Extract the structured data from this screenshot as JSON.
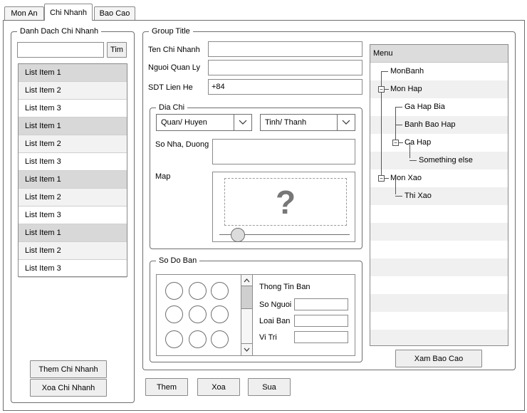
{
  "tabs": [
    {
      "label": "Mon An"
    },
    {
      "label": "Chi Nhanh"
    },
    {
      "label": "Bao Cao"
    }
  ],
  "branch_list": {
    "title": "Danh Dach Chi Nhanh",
    "search_value": "",
    "search_button": "Tim",
    "items": [
      {
        "label": "List Item 1"
      },
      {
        "label": "List Item 2"
      },
      {
        "label": "List Item 3"
      },
      {
        "label": "List Item 1"
      },
      {
        "label": "List Item 2"
      },
      {
        "label": "List Item 3"
      },
      {
        "label": "List Item 1"
      },
      {
        "label": "List Item 2"
      },
      {
        "label": "List Item 3"
      },
      {
        "label": "List Item 1"
      },
      {
        "label": "List Item 2"
      },
      {
        "label": "List Item 3"
      }
    ],
    "add_button": "Them Chi Nhanh",
    "delete_button": "Xoa Chi Nhanh"
  },
  "details": {
    "title": "Group Title",
    "name_label": "Ten Chi Nhanh",
    "name_value": "",
    "manager_label": "Nguoi Quan Ly",
    "manager_value": "",
    "phone_label": "SDT Lien He",
    "phone_value": "+84",
    "address": {
      "title": "Dia Chi",
      "district": "Quan/ Huyen",
      "province": "Tinh/ Thanh",
      "street_label": "So Nha, Duong",
      "street_value": "",
      "map_label": "Map",
      "map_placeholder": "?",
      "map_zoom_fraction": 0.14
    },
    "table_layout": {
      "title": "So Do Ban",
      "info_title": "Thong Tin Ban",
      "people_label": "So Nguoi",
      "people_value": "",
      "type_label": "Loai Ban",
      "type_value": "",
      "position_label": "Vi Tri",
      "position_value": ""
    }
  },
  "menu_tree": {
    "header": "Menu",
    "nodes": [
      {
        "label": "MonBanh"
      },
      {
        "label": "Mon Hap"
      },
      {
        "label": "Ga Hap Bia"
      },
      {
        "label": "Banh Bao Hap"
      },
      {
        "label": "Ca Hap"
      },
      {
        "label": "Something else"
      },
      {
        "label": "Mon Xao"
      },
      {
        "label": "Thi Xao"
      }
    ],
    "expander_collapse": "−"
  },
  "report_button": "Xam Bao Cao",
  "actions": {
    "add": "Them",
    "delete": "Xoa",
    "edit": "Sua"
  },
  "colors": {
    "border": "#6e6e6e",
    "selected_row": "#d8d8d8",
    "button_bg": "#efefef"
  }
}
